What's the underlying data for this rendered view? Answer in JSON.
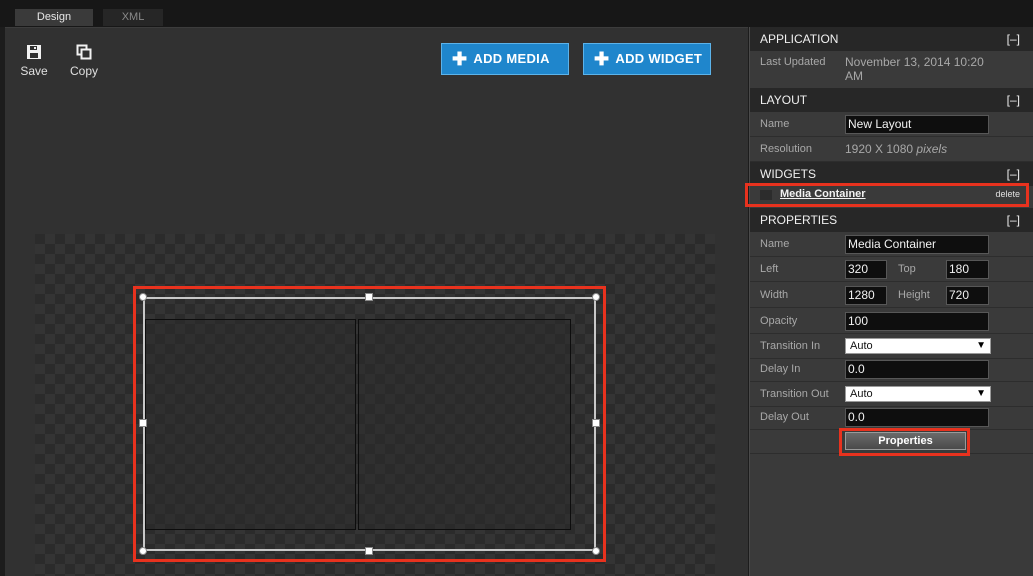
{
  "tabs": [
    {
      "label": "Design",
      "active": true
    },
    {
      "label": "XML",
      "active": false
    }
  ],
  "toolbar": {
    "save_label": "Save",
    "copy_label": "Copy",
    "add_media_label": "ADD MEDIA",
    "add_widget_label": "ADD WIDGET"
  },
  "panel": {
    "application": {
      "title": "APPLICATION",
      "collapse": "[–]",
      "last_updated_label": "Last Updated",
      "last_updated_line1": "November 13, 2014 10:20",
      "last_updated_line2": "AM"
    },
    "layout": {
      "title": "LAYOUT",
      "collapse": "[–]",
      "name_label": "Name",
      "name_value": "New Layout",
      "resolution_label": "Resolution",
      "resolution_value": "1920 X 1080",
      "resolution_unit": "pixels"
    },
    "widgets": {
      "title": "WIDGETS",
      "collapse": "[–]",
      "item_label": "Media Container",
      "delete_label": "delete"
    },
    "properties": {
      "title": "PROPERTIES",
      "collapse": "[–]",
      "name_label": "Name",
      "name_value": "Media Container",
      "left_label": "Left",
      "left_value": "320",
      "top_label": "Top",
      "top_value": "180",
      "width_label": "Width",
      "width_value": "1280",
      "height_label": "Height",
      "height_value": "720",
      "opacity_label": "Opacity",
      "opacity_value": "100",
      "transition_in_label": "Transition In",
      "transition_in_value": "Auto",
      "delay_in_label": "Delay In",
      "delay_in_value": "0.0",
      "transition_out_label": "Transition Out",
      "transition_out_value": "Auto",
      "delay_out_label": "Delay Out",
      "delay_out_value": "0.0",
      "button_label": "Properties"
    }
  },
  "colors": {
    "accent_blue": "#1f86cc",
    "highlight_red": "#e8321e"
  },
  "icons": [
    "save-icon",
    "copy-icon",
    "plus-icon",
    "dropdown-arrow-icon"
  ]
}
